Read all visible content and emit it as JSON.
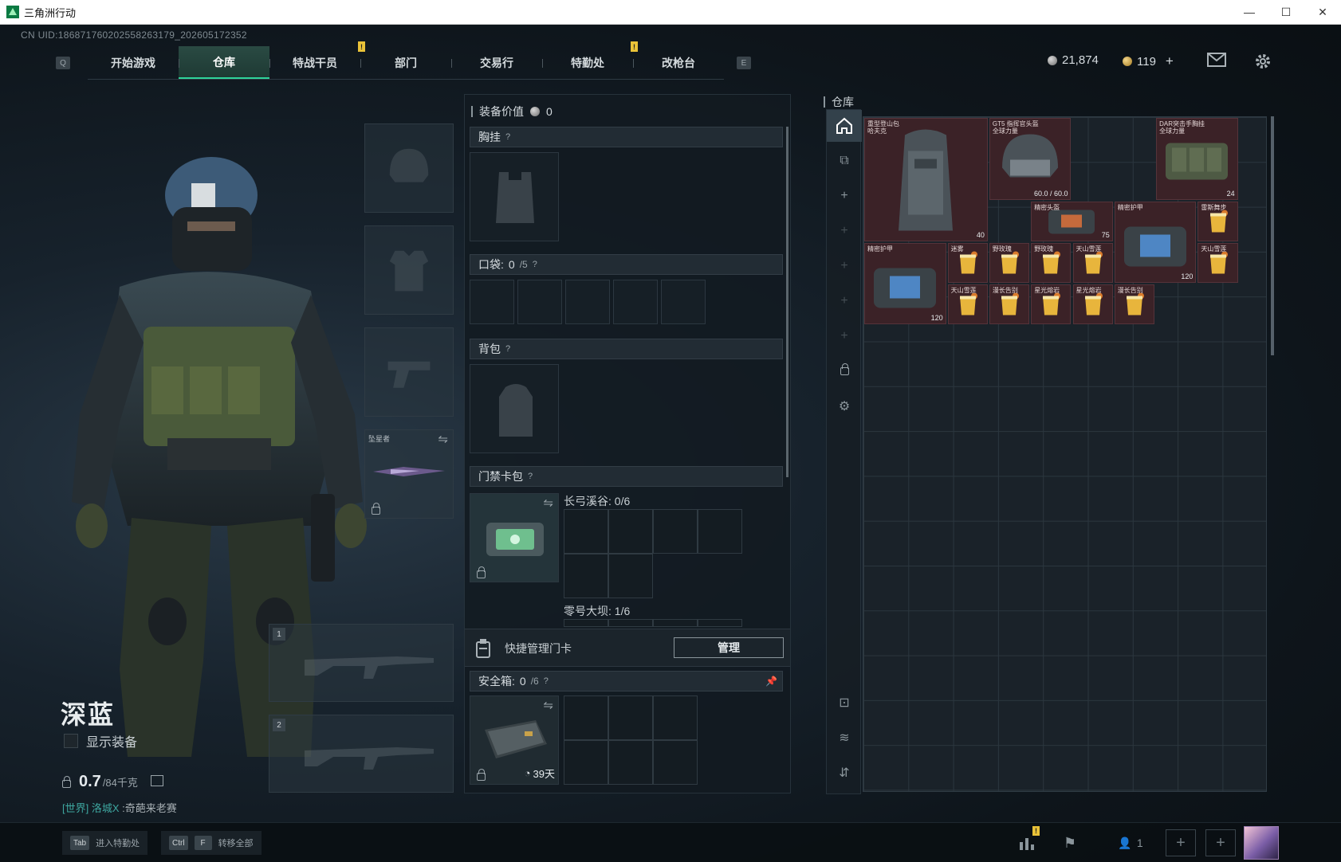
{
  "window": {
    "title": "三角洲行动",
    "minimize": "—",
    "maximize": "☐",
    "close": "✕"
  },
  "uid": "CN UID:1868717602025582631​79_202605172352",
  "nav": {
    "left_key": "Q",
    "right_key": "E",
    "tabs": [
      {
        "label": "开始游戏",
        "active": false,
        "notif": ""
      },
      {
        "label": "仓库",
        "active": true,
        "notif": ""
      },
      {
        "label": "特战干员",
        "active": false,
        "notif": "!"
      },
      {
        "label": "部门",
        "active": false,
        "notif": ""
      },
      {
        "label": "交易行",
        "active": false,
        "notif": ""
      },
      {
        "label": "特勤处",
        "active": false,
        "notif": "!"
      },
      {
        "label": "改枪台",
        "active": false,
        "notif": ""
      }
    ]
  },
  "currency": {
    "silver": "21,874",
    "gold": "119",
    "gold_add": "+"
  },
  "operator": {
    "name": "深蓝",
    "show_equipment": "显示装备",
    "weight_value": "0.7",
    "weight_max": "/84千克",
    "chat_channel": "[世界]",
    "chat_user": "洛城X",
    "chat_msg": ":奇葩来老赛"
  },
  "slots": {
    "melee_label": "坠星者",
    "weapon1_num": "1",
    "weapon2_num": "2"
  },
  "loadout": {
    "value_label": "装备价值",
    "value": "0",
    "chest_rig": "胸挂",
    "pockets": "口袋:",
    "pockets_count": "0",
    "pockets_max": "/5",
    "backpack": "背包",
    "keycard_case": "门禁卡包",
    "key_map1": "长弓溪谷: 0/6",
    "key_map2": "零号大坝: 1/6",
    "quick_manage": "快捷管理门卡",
    "manage_btn": "管理",
    "safebox": "安全箱:",
    "safebox_count": "0",
    "safebox_max": "/6",
    "safebox_days": "39天",
    "help": "?"
  },
  "warehouse": {
    "title": "仓库",
    "items": [
      {
        "name": "重型登山包\n哈夫克",
        "stat": "40"
      },
      {
        "name": "GT5 指挥官头盔\n全球力量",
        "stat": "60.0 / 60.0"
      },
      {
        "name": "DAR突击手胸挂\n全球力量",
        "stat": "24"
      },
      {
        "name": "精密头盔",
        "stat": "75"
      },
      {
        "name": "精密护甲",
        "stat": "120"
      },
      {
        "name": "雷斯舞步",
        "stat": ""
      },
      {
        "name": "精密护甲",
        "stat": "120"
      },
      {
        "name": "迷雾",
        "stat": ""
      },
      {
        "name": "野玫瑰",
        "stat": ""
      },
      {
        "name": "野玫瑰",
        "stat": ""
      },
      {
        "name": "天山雪莲",
        "stat": ""
      },
      {
        "name": "天山雪莲",
        "stat": ""
      },
      {
        "name": "天山雪莲",
        "stat": ""
      },
      {
        "name": "漫长告别",
        "stat": ""
      },
      {
        "name": "星光熔岩",
        "stat": ""
      },
      {
        "name": "星光熔岩",
        "stat": ""
      },
      {
        "name": "漫长告别",
        "stat": ""
      }
    ]
  },
  "bottom": {
    "tab_key": "Tab",
    "tab_label": "进入特勤处",
    "ctrl_key": "Ctrl",
    "f_key": "F",
    "transfer_label": "转移全部",
    "squad_count": "1",
    "notif": "!"
  },
  "colors": {
    "accent": "#2ed39a",
    "item_bg": "#3b2227",
    "notif": "#e9c238"
  }
}
